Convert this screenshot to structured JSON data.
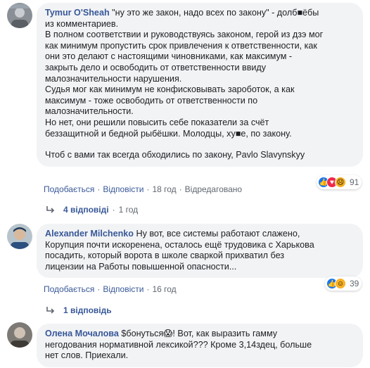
{
  "comments": [
    {
      "author": "Tymur O'Sheah",
      "lines_first": " \"ну это же закон, надо всех по закону\" - долб■ёбы",
      "lines": [
        "из комментариев.",
        "В полном соответствии и руководствуясь законом, герой из дзэ мог",
        "как минимум пропустить срок привлечения к ответственности, как",
        "они это делают с настоящими чиновниками, как максимум -",
        "закрыть дело и освободить от ответственности ввиду",
        "малозначительности нарушения.",
        "Судья мог как минимум не конфисковывать зароботок, а как",
        "максимум - тоже освободить от ответственности по",
        "малозначительности.",
        "Но нет, они решили повысить себе показатели за счёт",
        "беззащитной и бедной рыбёшки. Молодцы, ху■е, по закону."
      ],
      "last_line": "Чтоб с вами так всегда обходились по закону, Pavlo Slavynskyy",
      "actions": {
        "like": "Подобається",
        "reply": "Відповісти",
        "time": "18 год",
        "edited": "Відредаговано"
      },
      "reactions": {
        "icons": [
          "like-icon",
          "love-icon",
          "sad-icon"
        ],
        "count": "91"
      },
      "replies": {
        "label": "4 відповіді",
        "time": "1 год"
      }
    },
    {
      "author": "Alexander Milchenko",
      "lines_first": " Ну вот, все системы работают слажено,",
      "lines": [
        "Корупция почти искоренена, осталось ещё трудовика с Харькова",
        "посадить, который ворота в школе сваркой прихватил без",
        "лицензии на Работы повышенной опасности..."
      ],
      "actions": {
        "like": "Подобається",
        "reply": "Відповісти",
        "time": "16 год"
      },
      "reactions": {
        "icons": [
          "like-icon",
          "haha-icon"
        ],
        "count": "39"
      },
      "replies": {
        "label": "1 відповідь"
      }
    },
    {
      "author": "Олена Мочалова",
      "lines_first": " $бонуться😱! Вот, как выразить гамму",
      "lines": [
        "негодования нормативной лексикой??? Кроме 3,14здец, больше",
        "нет слов. Приехали."
      ]
    }
  ],
  "colors": {
    "link": "#385898",
    "bubble": "#f2f3f5",
    "muted": "#606770"
  }
}
